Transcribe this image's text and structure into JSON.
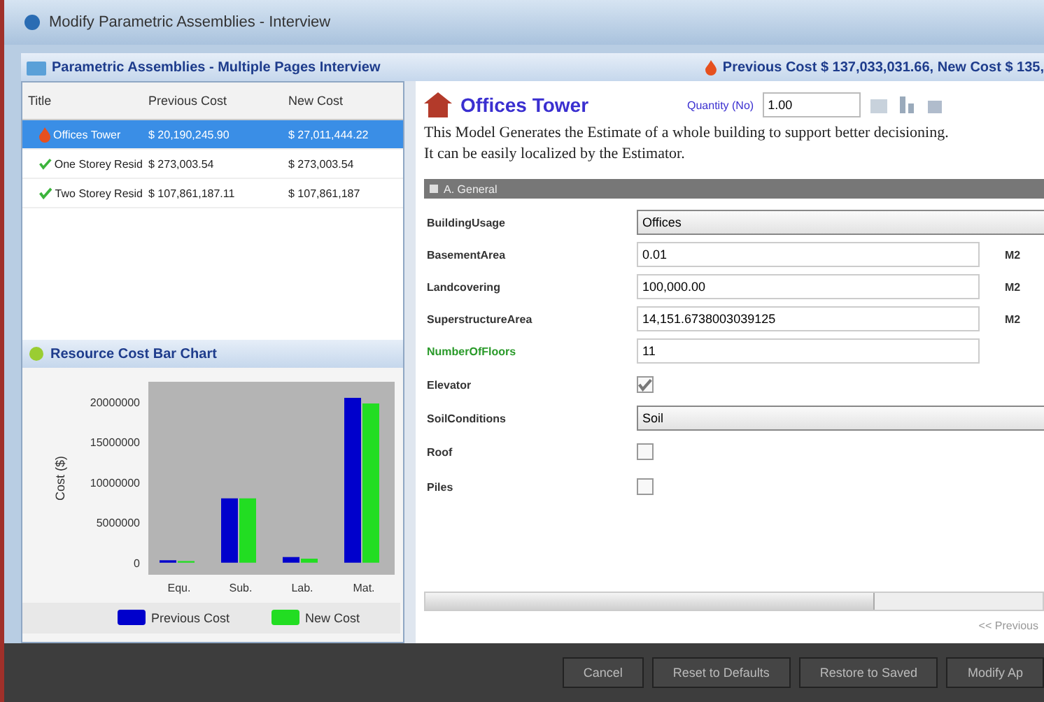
{
  "window": {
    "title": "Modify Parametric Assemblies - Interview"
  },
  "header": {
    "title": "Parametric Assemblies - Multiple Pages Interview",
    "cost_summary": "Previous Cost $ 137,033,031.66, New Cost $ 135,"
  },
  "tree": {
    "columns": [
      "Title",
      "Previous Cost",
      "New Cost"
    ],
    "rows": [
      {
        "title": "Offices Tower",
        "previous": "$ 20,190,245.90",
        "new": "$ 27,011,444.22",
        "selected": true,
        "kind": "modified"
      },
      {
        "title": "One Storey Resid",
        "previous": "$ 273,003.54",
        "new": "$ 273,003.54",
        "selected": false,
        "kind": "ok"
      },
      {
        "title": "Two Storey Resid",
        "previous": "$ 107,861,187.11",
        "new": "$ 107,861,187",
        "selected": false,
        "kind": "ok"
      }
    ]
  },
  "chart_panel": {
    "title": "Resource Cost Bar Chart",
    "chart_data": {
      "type": "bar",
      "ylabel": "Cost ($)",
      "categories": [
        "Equ.",
        "Sub.",
        "Lab.",
        "Mat."
      ],
      "series": [
        {
          "name": "Previous Cost",
          "color": "#0000cc",
          "values": [
            300000,
            8000000,
            700000,
            20500000
          ]
        },
        {
          "name": "New Cost",
          "color": "#22dd22",
          "values": [
            200000,
            8000000,
            500000,
            19800000
          ]
        }
      ],
      "legend": "bottom",
      "ylim": [
        -1500000,
        22500000
      ],
      "yticks": [
        0,
        5000000,
        10000000,
        15000000,
        20000000
      ]
    }
  },
  "model": {
    "title": "Offices Tower",
    "quantity_label": "Quantity (No)",
    "quantity": "1.00",
    "description": "This Model Generates the Estimate of a whole building to support better decisioning.\nIt can be easily localized by the Estimator."
  },
  "section": {
    "title": "A. General"
  },
  "fields": [
    {
      "kind": "dropdown",
      "label": "BuildingUsage",
      "value": "Offices",
      "highlight": false
    },
    {
      "kind": "text",
      "label": "BasementArea",
      "value": "0.01",
      "unit": "M2",
      "highlight": false
    },
    {
      "kind": "text",
      "label": "Landcovering",
      "value": "100,000.00",
      "unit": "M2",
      "highlight": false
    },
    {
      "kind": "text",
      "label": "SuperstructureArea",
      "value": "14,151.6738003039125",
      "unit": "M2",
      "highlight": false
    },
    {
      "kind": "text",
      "label": "NumberOfFloors",
      "value": "11",
      "highlight": true
    },
    {
      "kind": "checkbox",
      "label": "Elevator",
      "checked": true,
      "highlight": false
    },
    {
      "kind": "dropdown",
      "label": "SoilConditions",
      "value": "Soil",
      "highlight": false
    },
    {
      "kind": "checkbox",
      "label": "Roof",
      "checked": false,
      "highlight": false
    },
    {
      "kind": "checkbox",
      "label": "Piles",
      "checked": false,
      "highlight": false
    }
  ],
  "previous_link": "<< Previous",
  "buttons": [
    "Cancel",
    "Reset to Defaults",
    "Restore to Saved",
    "Modify Ap"
  ]
}
